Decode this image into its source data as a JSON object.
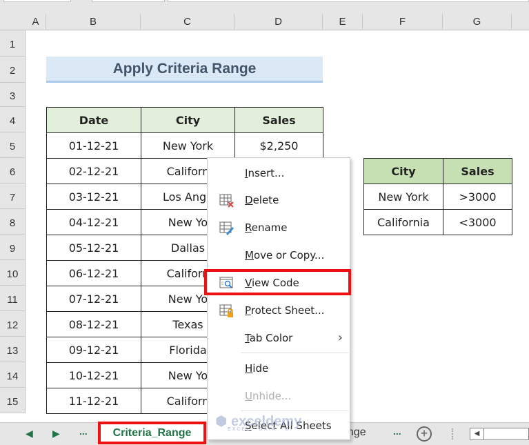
{
  "spreadsheet": {
    "columns": [
      "A",
      "B",
      "C",
      "D",
      "E",
      "F",
      "G"
    ],
    "rows": [
      "1",
      "2",
      "3",
      "4",
      "5",
      "6",
      "7",
      "8",
      "9",
      "10",
      "11",
      "12",
      "13",
      "14",
      "15"
    ],
    "title": "Apply Criteria Range",
    "main_table": {
      "headers": [
        "Date",
        "City",
        "Sales"
      ],
      "rows": [
        [
          "01-12-21",
          "New York",
          "$2,250"
        ],
        [
          "02-12-21",
          "Californ",
          ""
        ],
        [
          "03-12-21",
          "Los Ange",
          ""
        ],
        [
          "04-12-21",
          "New Yo",
          ""
        ],
        [
          "05-12-21",
          "Dallas",
          ""
        ],
        [
          "06-12-21",
          "Californ",
          ""
        ],
        [
          "07-12-21",
          "New Yo",
          ""
        ],
        [
          "08-12-21",
          "Texas",
          ""
        ],
        [
          "09-12-21",
          "Florida",
          ""
        ],
        [
          "10-12-21",
          "New Yo",
          ""
        ],
        [
          "11-12-21",
          "Californ",
          ""
        ]
      ]
    },
    "criteria_table": {
      "headers": [
        "City",
        "Sales"
      ],
      "rows": [
        [
          "New York",
          ">3000"
        ],
        [
          "California",
          "<3000"
        ]
      ]
    }
  },
  "context_menu": {
    "items": [
      {
        "label": "Insert...",
        "accel": "I",
        "icon": null,
        "disabled": false
      },
      {
        "label": "Delete",
        "accel": "D",
        "icon": "delete-sheet-icon",
        "disabled": false
      },
      {
        "label": "Rename",
        "accel": "R",
        "icon": "rename-sheet-icon",
        "disabled": false
      },
      {
        "label": "Move or Copy...",
        "accel": "M",
        "icon": null,
        "disabled": false
      },
      {
        "label": "View Code",
        "accel": "V",
        "icon": "view-code-icon",
        "disabled": false,
        "highlighted": true
      },
      {
        "label": "Protect Sheet...",
        "accel": "P",
        "icon": "protect-sheet-icon",
        "disabled": false
      },
      {
        "label": "Tab Color",
        "accel": "T",
        "icon": null,
        "disabled": false,
        "submenu": true
      },
      {
        "label": "Hide",
        "accel": "H",
        "icon": null,
        "disabled": false
      },
      {
        "label": "Unhide...",
        "accel": "U",
        "icon": null,
        "disabled": true
      },
      {
        "label": "Select All Sheets",
        "accel": "S",
        "icon": null,
        "disabled": false
      }
    ]
  },
  "sheet_tabs": {
    "prev_label": "◀",
    "next_label": "▶",
    "ellipsis_left": "...",
    "active": "Criteria_Range",
    "other_partial": "ange",
    "ellipsis_right": "...",
    "add_label": "+"
  },
  "watermark": {
    "name": "exceldemy",
    "tagline": "EXCEL · DATA · BI"
  },
  "colors": {
    "highlight": "#ee1111",
    "excel_green": "#217346",
    "header_green": "#e2efda",
    "title_blue": "#dbe8f5"
  }
}
